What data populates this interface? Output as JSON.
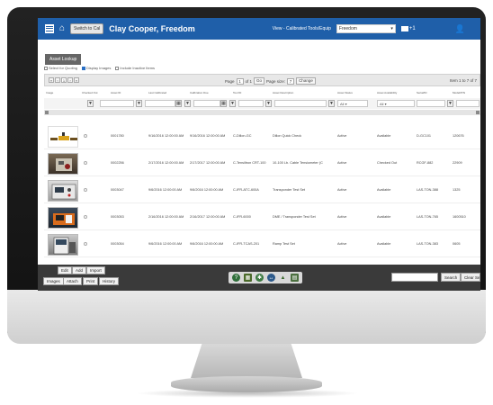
{
  "header": {
    "switch_label": "Switch to Cal",
    "user_name": "Clay Cooper, Freedom",
    "view_label": "View - Calibrated Tools/Equip",
    "view_value": "Freedom",
    "mail_count": "+1"
  },
  "panel": {
    "asset_lookup_label": "Asset Lookup",
    "checks": [
      "Select for Quoting",
      "Display Images",
      "Include Inactive Items"
    ]
  },
  "pager": {
    "page_label": "Page",
    "page_value": "1",
    "of_label": "of 1",
    "go_label": "Go",
    "page_size_label": "Page size:",
    "page_size_value": "7",
    "change_label": "Change",
    "items_label": "Item 1 to 7 of 7",
    "buttons": [
      "«",
      "‹",
      "1",
      "›",
      "»"
    ]
  },
  "columns": [
    "Image",
    "Checked Out",
    "Asset ID",
    "Last Calibrated",
    "Calibration Due",
    "Tool ID",
    "Asset Description",
    "Asset Status",
    "Asset Availability",
    "Serial/ID",
    "Model/P/N"
  ],
  "filters": {
    "status_value": "All",
    "availability_value": "All"
  },
  "rows": [
    {
      "asset_id": "0001780",
      "last_cal": "9/16/2016 12:00:00 AM",
      "cal_due": "9/16/2016 12:00:00 AM",
      "tool_id": "C-Dillon-GC",
      "desc": "Dillon Quick Check",
      "status": "Active",
      "availability": "Available",
      "serial": "D-GC101",
      "model": "120676"
    },
    {
      "asset_id": "0002256",
      "last_cal": "2/17/2016 12:00:00 AM",
      "cal_due": "2/17/2017 12:00:00 AM",
      "tool_id": "C-Tensiltron CRT-100",
      "desc": "10-100 Lb. Cable Tensiometer (C",
      "status": "Active",
      "availability": "Checked Out",
      "serial": "RCGF-882",
      "model": "22909"
    },
    {
      "asset_id": "0003047",
      "last_cal": "9/6/2016 12:00:00 AM",
      "cal_due": "9/6/2016 12:00:00 AM",
      "tool_id": "C-IFR-ATC-600A",
      "desc": "Transponder Test Set",
      "status": "Active",
      "availability": "Available",
      "serial": "LAS-TON-388",
      "model": "1325"
    },
    {
      "asset_id": "0003053",
      "last_cal": "2/16/2016 12:00:00 AM",
      "cal_due": "2/16/2017 12:00:00 AM",
      "tool_id": "C-IFR-6000",
      "desc": "DME / Transponder Test Set",
      "status": "Active",
      "availability": "Available",
      "serial": "LAS-TON-765",
      "model": "1600510"
    },
    {
      "asset_id": "0003054",
      "last_cal": "9/6/2016 12:00:00 AM",
      "cal_due": "9/6/2016 12:00:00 AM",
      "tool_id": "C-IFR-TCAS-201",
      "desc": "Ramp Test Set",
      "status": "Active",
      "availability": "Available",
      "serial": "LAS-TON-383",
      "model": "0605"
    }
  ],
  "footer": {
    "edit_label": "Edit",
    "add_label": "Add",
    "import_label": "Import",
    "images_label": "Images",
    "attach_label": "Attach",
    "print_label": "Print",
    "history_label": "History",
    "search_label": "Search",
    "clear_label": "Clear Search"
  },
  "icons": [
    "help-icon",
    "grid-icon",
    "settings-icon",
    "link-icon",
    "alert-icon",
    "document-icon"
  ],
  "colors": {
    "header": "#1f5fa9",
    "footer": "#3a3a3a"
  }
}
